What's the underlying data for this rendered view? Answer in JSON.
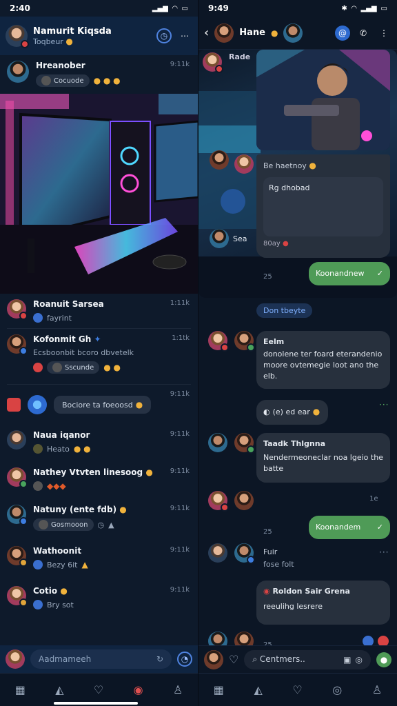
{
  "left": {
    "status": {
      "time": "2:40"
    },
    "header": {
      "title": "Namurit Kiqsda",
      "subtitle": "Toqbeur"
    },
    "first_row": {
      "name": "Hreanober",
      "snippet": "Cocuode",
      "time": "9:11k"
    },
    "chats": [
      {
        "name": "Roanuit Sarsea",
        "snippet": "fayrint",
        "time": "1:11k"
      },
      {
        "name": "Kofonmit Gh",
        "snippet": "Ecsboonbit bcoro dbvetelk",
        "snippet2": "Sscunde",
        "time": "1:1tk"
      },
      {
        "name": "Bociore ta foeoosd",
        "snippet": "",
        "time": "9:11k"
      },
      {
        "name": "Naua iqanor",
        "snippet": "Heato",
        "time": "9:11k"
      },
      {
        "name": "Nathey Vtvten linesoog",
        "snippet": "",
        "time": "9:11k"
      },
      {
        "name": "Natuny (ente fdb)",
        "snippet": "Gosmooon",
        "time": "9:11k"
      },
      {
        "name": "Wathoonit",
        "snippet": "Bezy 6it",
        "time": "9:11k"
      },
      {
        "name": "Cotio",
        "snippet": "Bry sot",
        "time": "9:11k"
      }
    ],
    "composer": {
      "placeholder": "Aadmameeh"
    }
  },
  "right": {
    "status": {
      "time": "9:49"
    },
    "header": {
      "title": "Hane"
    },
    "top_items": [
      {
        "text": "Rade",
        "time": ""
      },
      {
        "text": "Sea",
        "time": ""
      }
    ],
    "bubbles": {
      "b1": "Be haetnoy",
      "b2": "Rg dhobad",
      "b2_foot": "80ay",
      "out1": "Koonandnew",
      "ts1": "25",
      "chip": "Don tbeyte",
      "card_title": "Eelm",
      "card_text": "donolene ter foard eterandenio moore ovtemegie loot ano the elb.",
      "b3": "(e) ed ear",
      "card2_title": "Taadk Thlgnna",
      "card2_text": "Nendermeoneclar noa lgeio the batte",
      "ts2": "1e",
      "ts3": "25",
      "out2": "Koonandem",
      "name3": "Fuir",
      "sub3": "fose folt",
      "card3_title": "Roldon Sair Grena",
      "card3_text": "reeulihg lesrere",
      "ts4": "25"
    },
    "composer": {
      "placeholder": "Centmers.."
    }
  },
  "colors": {
    "accent": "#3d7de0",
    "out_bubble": "#4f9b57",
    "bg": "#0c1625"
  }
}
